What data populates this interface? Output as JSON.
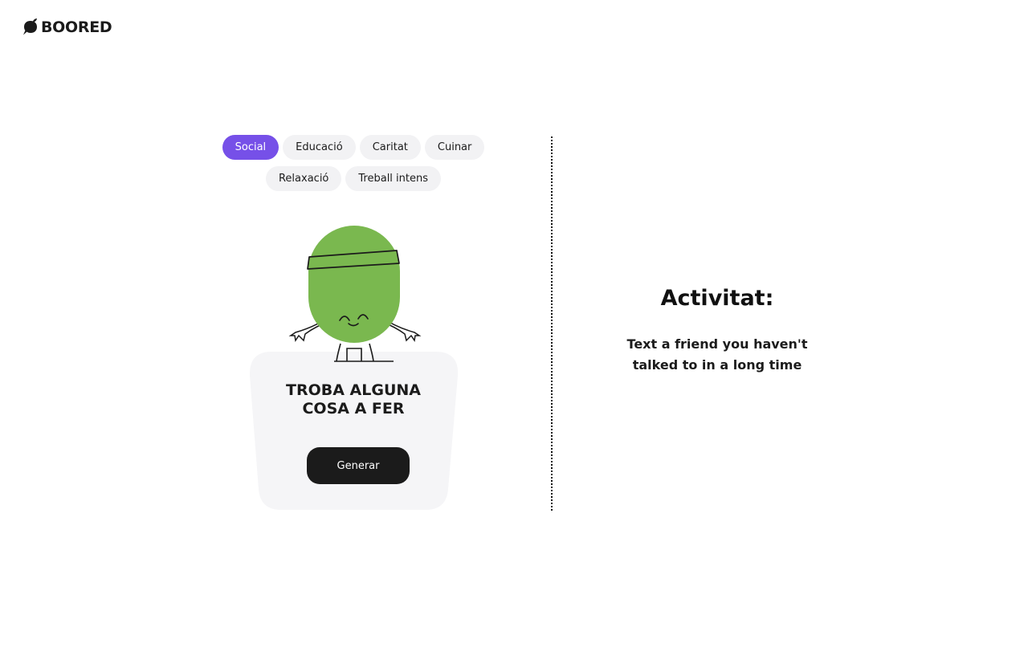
{
  "header": {
    "brand": "BOORED",
    "logo_icon": "leaf-speech-bubble-icon"
  },
  "categories": [
    {
      "label": "Social",
      "active": true
    },
    {
      "label": "Educació",
      "active": false
    },
    {
      "label": "Caritat",
      "active": false
    },
    {
      "label": "Cuinar",
      "active": false
    },
    {
      "label": "Relaxació",
      "active": false
    },
    {
      "label": "Treball intens",
      "active": false
    }
  ],
  "mascot": {
    "icon": "green-mascot-illustration",
    "color": "#7ab84f"
  },
  "card": {
    "title_line1": "TROBA ALGUNA",
    "title_line2": "COSA A FER",
    "button_label": "Generar"
  },
  "result": {
    "heading": "Activitat:",
    "line1": "Text a friend you haven't",
    "line2": "talked to in a long time"
  },
  "colors": {
    "accent": "#7650e8",
    "chip_bg": "#f2f2f4",
    "button_bg": "#1b1b1b",
    "card_bg": "#f5f5f7",
    "mascot_green": "#7ab84f"
  }
}
